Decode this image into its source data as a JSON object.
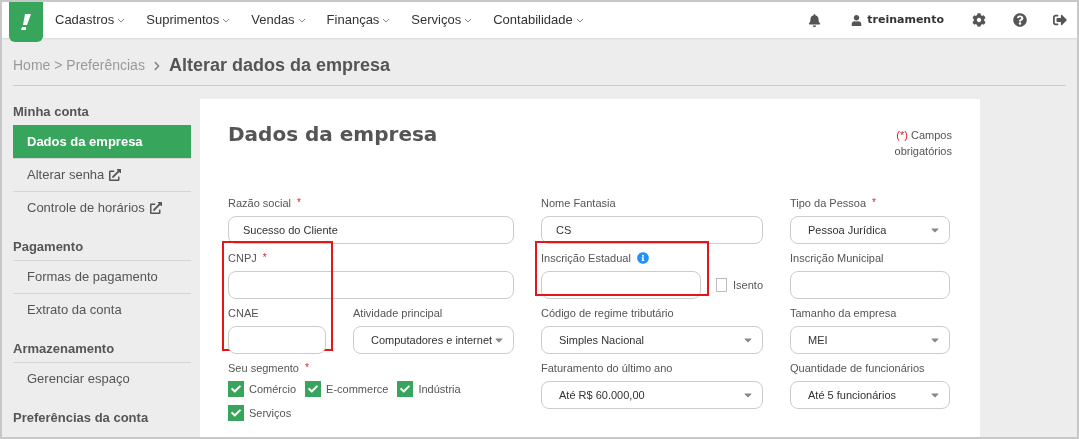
{
  "nav": {
    "menu": [
      {
        "label": "Cadastros"
      },
      {
        "label": "Suprimentos"
      },
      {
        "label": "Vendas"
      },
      {
        "label": "Finanças"
      },
      {
        "label": "Serviços"
      },
      {
        "label": "Contabilidade"
      }
    ],
    "user": "treinamento"
  },
  "breadcrumb": {
    "trail": "Home > Preferências",
    "current": "Alterar dados da empresa"
  },
  "sidebar": [
    {
      "title": "Minha conta",
      "items": [
        {
          "label": "Dados da empresa",
          "selected": true,
          "external": false
        },
        {
          "label": "Alterar senha",
          "selected": false,
          "external": true
        },
        {
          "label": "Controle de horários",
          "selected": false,
          "external": true
        }
      ]
    },
    {
      "title": "Pagamento",
      "items": [
        {
          "label": "Formas de pagamento",
          "selected": false,
          "external": false
        },
        {
          "label": "Extrato da conta",
          "selected": false,
          "external": false
        }
      ]
    },
    {
      "title": "Armazenamento",
      "items": [
        {
          "label": "Gerenciar espaço",
          "selected": false,
          "external": false
        }
      ]
    },
    {
      "title": "Preferências da conta"
    }
  ],
  "form": {
    "title": "Dados da empresa",
    "required_mark": "(*)",
    "required_note": "Campos obrigatórios",
    "rows": [
      [
        {
          "kind": "text",
          "label": "Razão social",
          "required_mark": "*",
          "value": "Sucesso do Cliente"
        },
        {
          "kind": "text",
          "label": "Nome Fantasia",
          "value": "CS"
        },
        {
          "kind": "select",
          "label": "Tipo da Pessoa",
          "required_mark": "*",
          "value": "Pessoa Jurídica"
        }
      ],
      [
        {
          "kind": "text",
          "label": "CNPJ",
          "required_mark": "*",
          "highlighted": true
        },
        {
          "kind": "text",
          "label": "Inscrição Estadual",
          "info": true,
          "highlighted": true,
          "exempt": {
            "label": "Isento",
            "checked": false
          }
        },
        {
          "kind": "text",
          "label": "Inscrição Municipal"
        }
      ],
      [
        {
          "kind": "pair",
          "fields": [
            {
              "kind": "text",
              "label": "CNAE"
            },
            {
              "kind": "select",
              "label": "Atividade principal",
              "value": "Computadores e internet"
            }
          ]
        },
        {
          "kind": "select",
          "label": "Código de regime tributário",
          "value": "Simples Nacional"
        },
        {
          "kind": "select",
          "label": "Tamanho da empresa",
          "value": "MEI"
        }
      ],
      [
        {
          "kind": "checks",
          "label": "Seu segmento",
          "required_mark": "*",
          "options": [
            {
              "label": "Comércio",
              "checked": true
            },
            {
              "label": "E-commerce",
              "checked": true
            },
            {
              "label": "Indústria",
              "checked": true
            },
            {
              "label": "Serviços",
              "checked": true
            }
          ]
        },
        {
          "kind": "select",
          "label": "Faturamento do último ano",
          "value": "Até R$ 60.000,00"
        },
        {
          "kind": "select",
          "label": "Quantidade de funcionários",
          "value": "Até 5 funcionários"
        }
      ]
    ]
  }
}
